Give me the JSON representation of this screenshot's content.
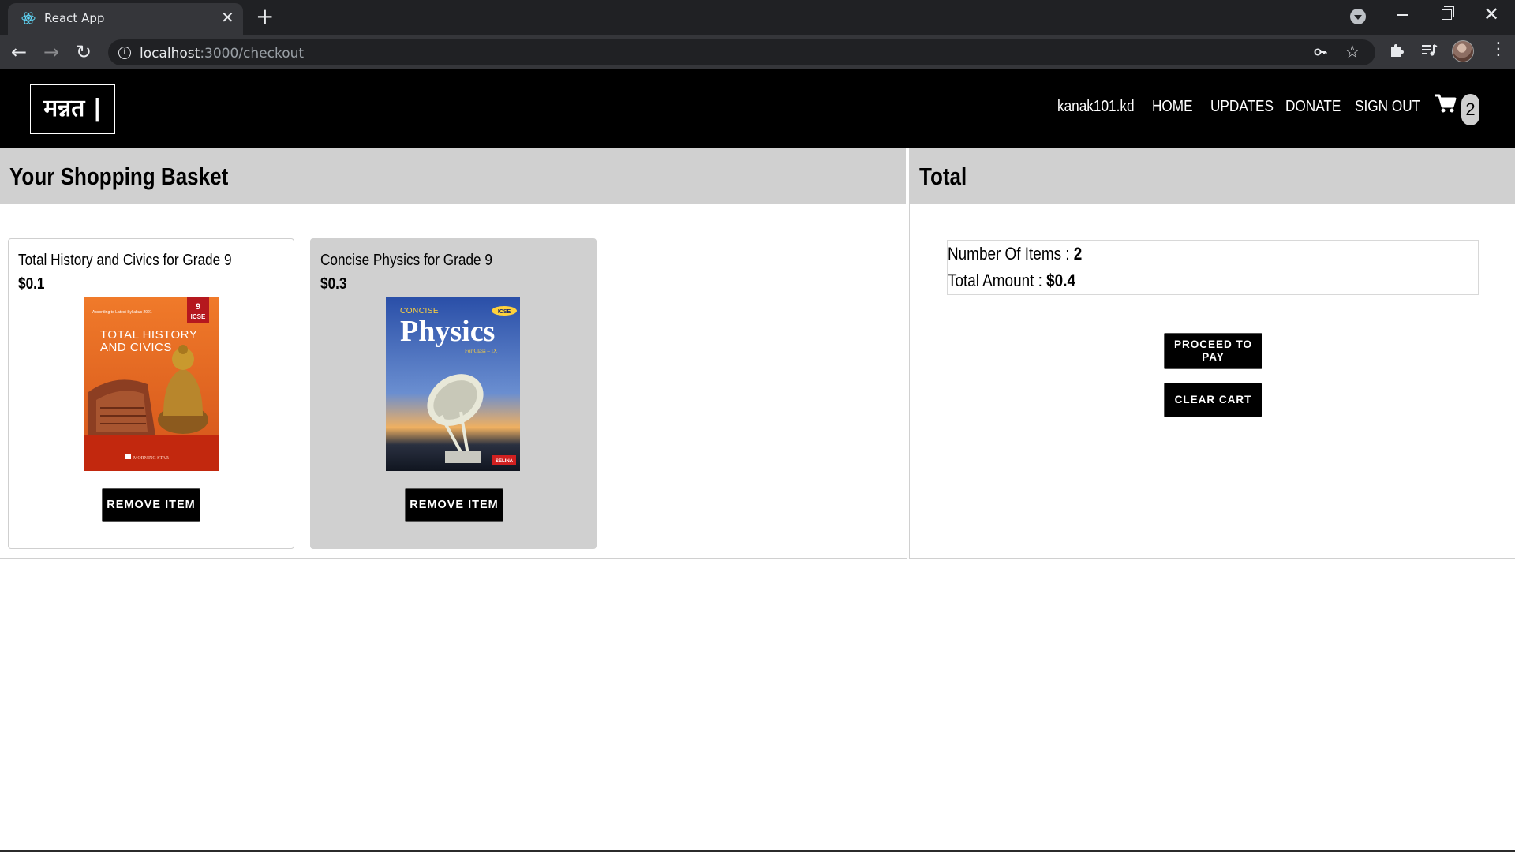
{
  "browser": {
    "tab_title": "React App",
    "tab_close": "✕",
    "new_tab": "+",
    "url_host": "localhost",
    "url_path": ":3000/checkout",
    "icons": [
      "react-favicon",
      "back-arrow-icon",
      "forward-arrow-icon",
      "reload-icon",
      "info-icon",
      "key-icon",
      "star-icon",
      "puzzle-icon",
      "media-icon",
      "profile-avatar",
      "menu-dots-icon"
    ]
  },
  "header": {
    "logo": "मन्नत |",
    "nav": {
      "user": "kanak101.kd",
      "home": "HOME",
      "updates": "UPDATES",
      "donate": "DONATE",
      "sign_out": "SIGN OUT"
    },
    "cart_count": "2"
  },
  "basket": {
    "title": "Your Shopping Basket",
    "items": [
      {
        "name": "Total History and Civics for Grade 9",
        "price": "$0.1",
        "cover_title": "TOTAL HISTORY AND CIVICS",
        "cover_badge": "9 ICSE",
        "cover_top": "According to Latest Syllabus 2021",
        "cover_publisher": "MORNING STAR",
        "remove_label": "REMOVE ITEM"
      },
      {
        "name": "Concise Physics for Grade 9",
        "price": "$0.3",
        "cover_brand": "CONCISE",
        "cover_badge": "ICSE",
        "cover_title": "Physics",
        "cover_sub": "For Class – IX",
        "cover_publisher": "SELINA",
        "remove_label": "REMOVE ITEM"
      }
    ]
  },
  "total": {
    "title": "Total",
    "items_label": "Number Of Items : ",
    "items_value": "2",
    "amount_label": "Total Amount : ",
    "amount_value": "$0.4",
    "pay_label": "PROCEED TO PAY",
    "clear_label": "CLEAR CART"
  },
  "colors": {
    "header_bg": "#000000",
    "panel_head_bg": "#d0d0d0",
    "button_bg": "#000000",
    "chrome_dark": "#202124",
    "chrome_tab": "#35363a"
  }
}
